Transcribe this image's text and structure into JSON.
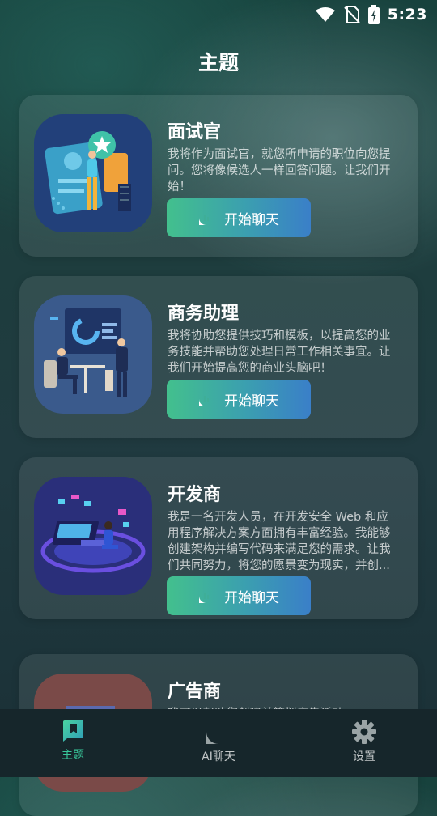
{
  "status_bar": {
    "time": "5:23"
  },
  "header": {
    "title": "主题"
  },
  "cards": [
    {
      "title": "面试官",
      "description": "我将作为面试官，就您所申请的职位向您提问。您将像候选人一样回答问题。让我们开始！",
      "button_label": "开始聊天"
    },
    {
      "title": "商务助理",
      "description": "我将协助您提供技巧和模板，以提高您的业务技能并帮助您处理日常工作相关事宜。让我们开始提高您的商业头脑吧！",
      "button_label": "开始聊天"
    },
    {
      "title": "开发商",
      "description": "我是一名开发人员，在开发安全 Web 和应用程序解决方案方面拥有丰富经验。我能够创建架构并编写代码来满足您的需求。让我们共同努力，将您的愿景变为现实，并创...",
      "button_label": "开始聊天"
    },
    {
      "title": "广告商",
      "description": "我可以帮助您创建并策划广告活动"
    }
  ],
  "bottom_nav": {
    "items": [
      {
        "label": "主题",
        "icon": "bookmark-icon",
        "active": true
      },
      {
        "label": "AI聊天",
        "icon": "chat-bubble-icon",
        "active": false
      },
      {
        "label": "设置",
        "icon": "gear-icon",
        "active": false
      }
    ],
    "accent_color": "#38c79a"
  }
}
